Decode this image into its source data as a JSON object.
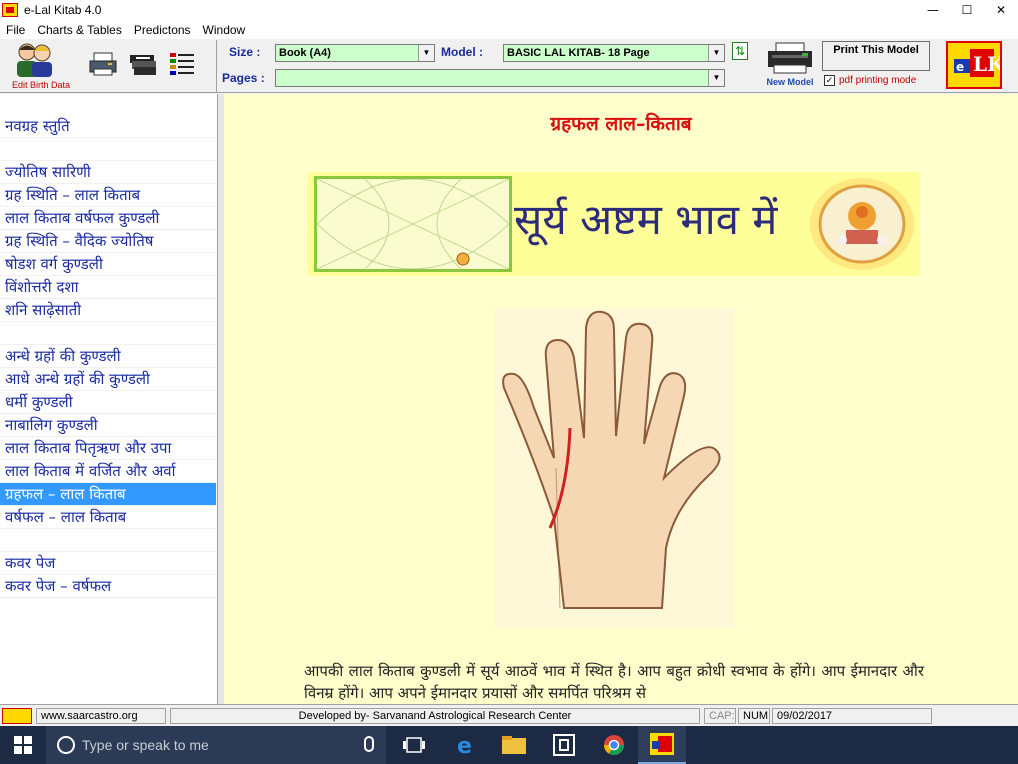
{
  "window": {
    "title": "e-Lal Kitab 4.0",
    "controls": {
      "minimize": "—",
      "maximize": "☐",
      "close": "✕"
    }
  },
  "menu": [
    "File",
    "Charts & Tables",
    "Predictons",
    "Window"
  ],
  "toolbar": {
    "edit_birth_data": "Edit Birth Data",
    "size_label": "Size :",
    "size_value": "Book (A4)",
    "model_label": "Model :",
    "model_value": "BASIC LAL KITAB- 18 Page",
    "pages_label": "Pages :",
    "pages_value": "",
    "new_model": "New Model",
    "print_model": "Print This Model",
    "pdf_mode": "pdf printing mode",
    "pdf_checked": true
  },
  "sidebar": {
    "items": [
      {
        "label": "नवग्रह स्तुति",
        "gap_before": 0
      },
      {
        "label": "ज्योतिष सारिणी",
        "gap_before": 1
      },
      {
        "label": "ग्रह स्थिति – लाल किताब",
        "gap_before": 0
      },
      {
        "label": "लाल किताब वर्षफल कुण्डली",
        "gap_before": 0
      },
      {
        "label": "ग्रह स्थिति – वैदिक ज्योतिष",
        "gap_before": 0
      },
      {
        "label": "षोडश वर्ग कुण्डली",
        "gap_before": 0
      },
      {
        "label": "विंशोत्तरी दशा",
        "gap_before": 0
      },
      {
        "label": "शनि साढ़ेसाती",
        "gap_before": 0
      },
      {
        "label": "अन्धे ग्रहों की कुण्डली",
        "gap_before": 1
      },
      {
        "label": "आधे अन्धे ग्रहों की कुण्डली",
        "gap_before": 0
      },
      {
        "label": "धर्मी कुण्डली",
        "gap_before": 0
      },
      {
        "label": "नाबालिग कुण्डली",
        "gap_before": 0
      },
      {
        "label": "लाल किताब पितृऋण और उपा",
        "gap_before": 0
      },
      {
        "label": "लाल किताब में वर्जित और अर्वा",
        "gap_before": 0
      },
      {
        "label": "ग्रहफल – लाल किताब",
        "gap_before": 0,
        "selected": true
      },
      {
        "label": "वर्षफल – लाल किताब",
        "gap_before": 0
      },
      {
        "label": "कवर पेज",
        "gap_before": 1
      },
      {
        "label": "कवर पेज – वर्षफल",
        "gap_before": 0
      }
    ],
    "selected_color": "#3399ff"
  },
  "main": {
    "page_title": "ग्रहफल लाल–किताब",
    "headline": "सूर्य अष्टम भाव में",
    "paragraph": "आपकी लाल किताब कुण्डली में सूर्य आठवें भाव में स्थित है। आप बहुत क्रोधी स्वभाव के होंगे। आप ईमानदार और विनम्र होंगे। आप अपने ईमानदार प्रयासों और समर्पित परिश्रम से",
    "title_color": "#d81010",
    "background": "#ffffcc"
  },
  "statusbar": {
    "website": "www.saarcastro.org",
    "developer": "Developed by- Sarvanand Astrological Research Center",
    "caps": "CAP:",
    "num": "NUM",
    "date": "09/02/2017"
  },
  "taskbar": {
    "search_placeholder": "Type or speak to me",
    "apps": [
      "task-view-icon",
      "edge-icon",
      "file-explorer-icon",
      "store-icon",
      "chrome-icon",
      "lal-kitab-icon"
    ]
  }
}
